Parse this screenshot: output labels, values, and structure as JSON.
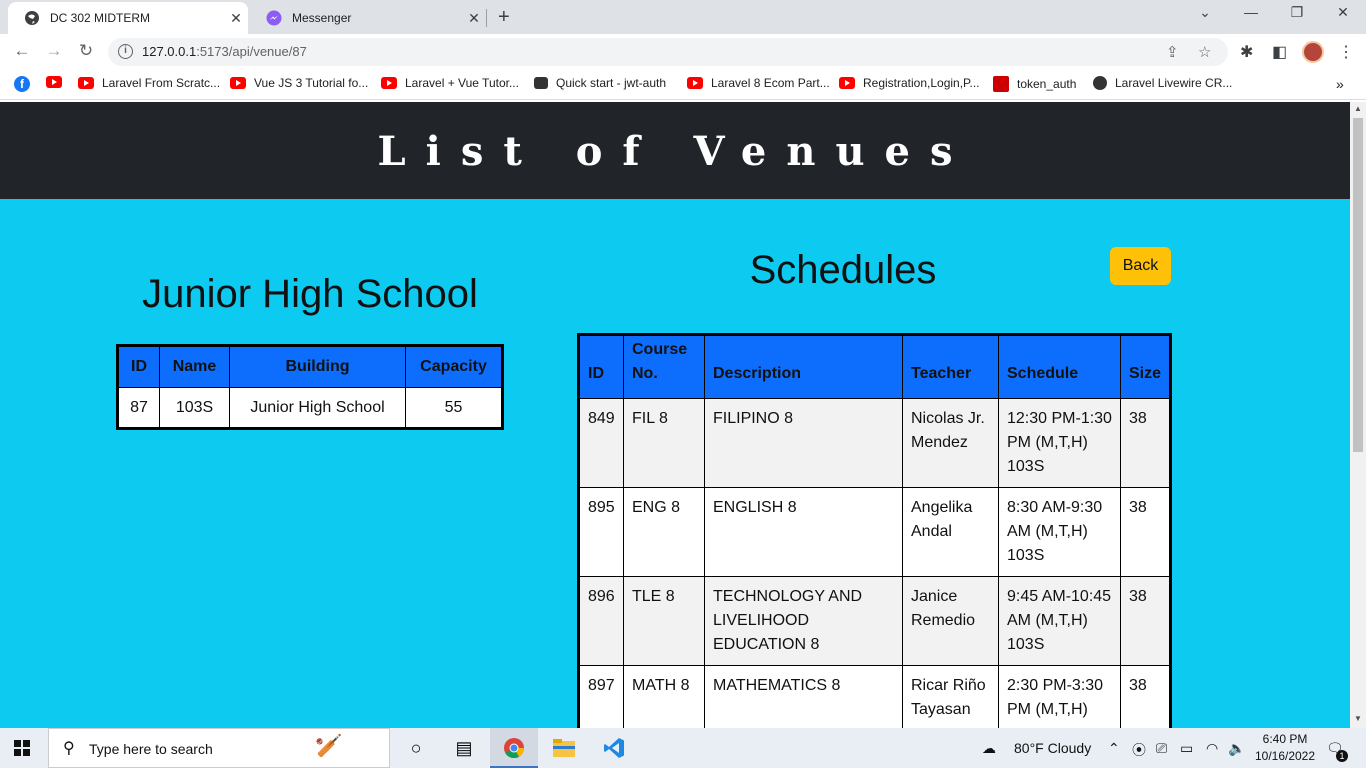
{
  "browser": {
    "tabs": [
      {
        "title": "DC 302 MIDTERM",
        "active": true
      },
      {
        "title": "Messenger",
        "active": false
      }
    ],
    "url_host": "127.0.0.1",
    "url_path": ":5173/api/venue/87",
    "bookmarks": [
      "Laravel From Scratc...",
      "Vue JS 3 Tutorial fo...",
      "Laravel + Vue Tutor...",
      "Quick start - jwt-auth",
      "Laravel 8 Ecom Part...",
      "Registration,Login,P...",
      "token_auth",
      "Laravel Livewire CR..."
    ]
  },
  "page": {
    "header_title": "List of Venues",
    "venue_title": "Junior High School",
    "schedules_title": "Schedules",
    "back_label": "Back"
  },
  "venue_table": {
    "headers": [
      "ID",
      "Name",
      "Building",
      "Capacity"
    ],
    "row": [
      "87",
      "103S",
      "Junior High School",
      "55"
    ]
  },
  "schedules_table": {
    "headers": [
      "ID",
      "Course No.",
      "Description",
      "Teacher",
      "Schedule",
      "Size"
    ],
    "rows": [
      [
        "849",
        "FIL 8",
        "FILIPINO 8",
        "Nicolas Jr. Mendez",
        "12:30 PM-1:30 PM (M,T,H) 103S",
        "38"
      ],
      [
        "895",
        "ENG 8",
        "ENGLISH 8",
        "Angelika Andal",
        "8:30 AM-9:30 AM (M,T,H) 103S",
        "38"
      ],
      [
        "896",
        "TLE 8",
        "TECHNOLOGY AND LIVELIHOOD EDUCATION 8",
        "Janice Remedio",
        "9:45 AM-10:45 AM (M,T,H) 103S",
        "38"
      ],
      [
        "897",
        "MATH 8",
        "MATHEMATICS 8",
        "Ricar Riño Tayasan",
        "2:30 PM-3:30 PM (M,T,H)",
        "38"
      ]
    ]
  },
  "taskbar": {
    "search_placeholder": "Type here to search",
    "weather": "80°F  Cloudy",
    "time": "6:40 PM",
    "date": "10/16/2022",
    "notification_count": "1"
  }
}
